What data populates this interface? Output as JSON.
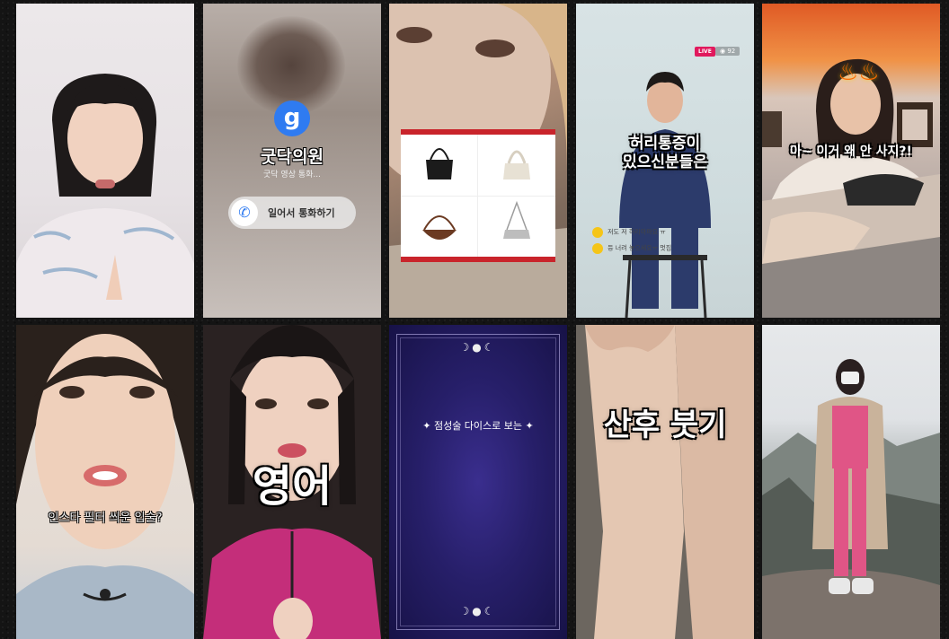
{
  "tiles": {
    "t1": {},
    "t2": {
      "brand_glyph": "g",
      "title": "굿닥의원",
      "subtitle": "굿닥 영상 통화...",
      "call_label": "일어서 통화하기"
    },
    "t3": {},
    "t4": {
      "live_badge": "LIVE",
      "viewers": "92",
      "caption": "허리통증이\n있으신분들은",
      "comments": [
        {
          "text": "저도 저 허리아파요 ㅠ"
        },
        {
          "text": "등 너려 놓으세요ㅠ 멋집"
        }
      ]
    },
    "t5": {
      "caption": "아~ 이거 왜 안 사지?!"
    },
    "t6": {
      "caption": "인스타 필터 씌운 입술?"
    },
    "t7": {
      "caption": "영어"
    },
    "t8": {
      "moons": "☽●☾",
      "caption": "점성술 다이스로 보는"
    },
    "t9": {
      "caption": "산후 붓기"
    },
    "t10": {}
  }
}
